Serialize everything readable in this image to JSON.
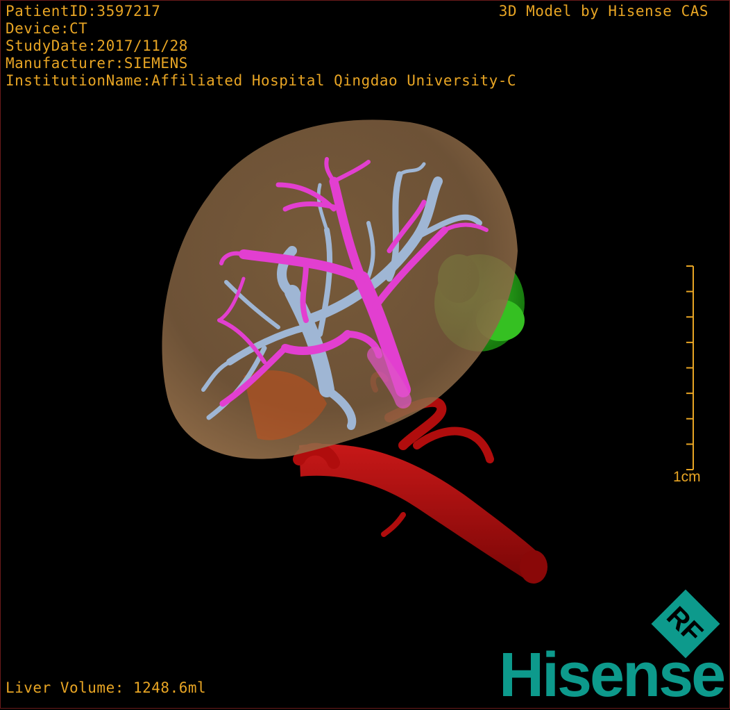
{
  "overlay": {
    "patient_id": "PatientID:3597217",
    "device": "Device:CT",
    "study_date": "StudyDate:2017/11/28",
    "manufacturer": "Manufacturer:SIEMENS",
    "institution": "InstitutionName:Affiliated Hospital Qingdao University-C",
    "credit": "3D Model by Hisense CAS",
    "liver_volume": "Liver Volume: 1248.6ml"
  },
  "scale": {
    "label": "1cm",
    "ticks": 9
  },
  "logo": {
    "brand": "Hisense",
    "badge": "RF"
  },
  "colors": {
    "overlay_text": "#e8a524",
    "liver": "#b48a5c",
    "portal_vein": "#e23fd0",
    "hepatic_vein": "#9fb6d4",
    "artery": "#b00d0d",
    "tumor": "#2ea81c",
    "brand": "#0d9a8c"
  }
}
